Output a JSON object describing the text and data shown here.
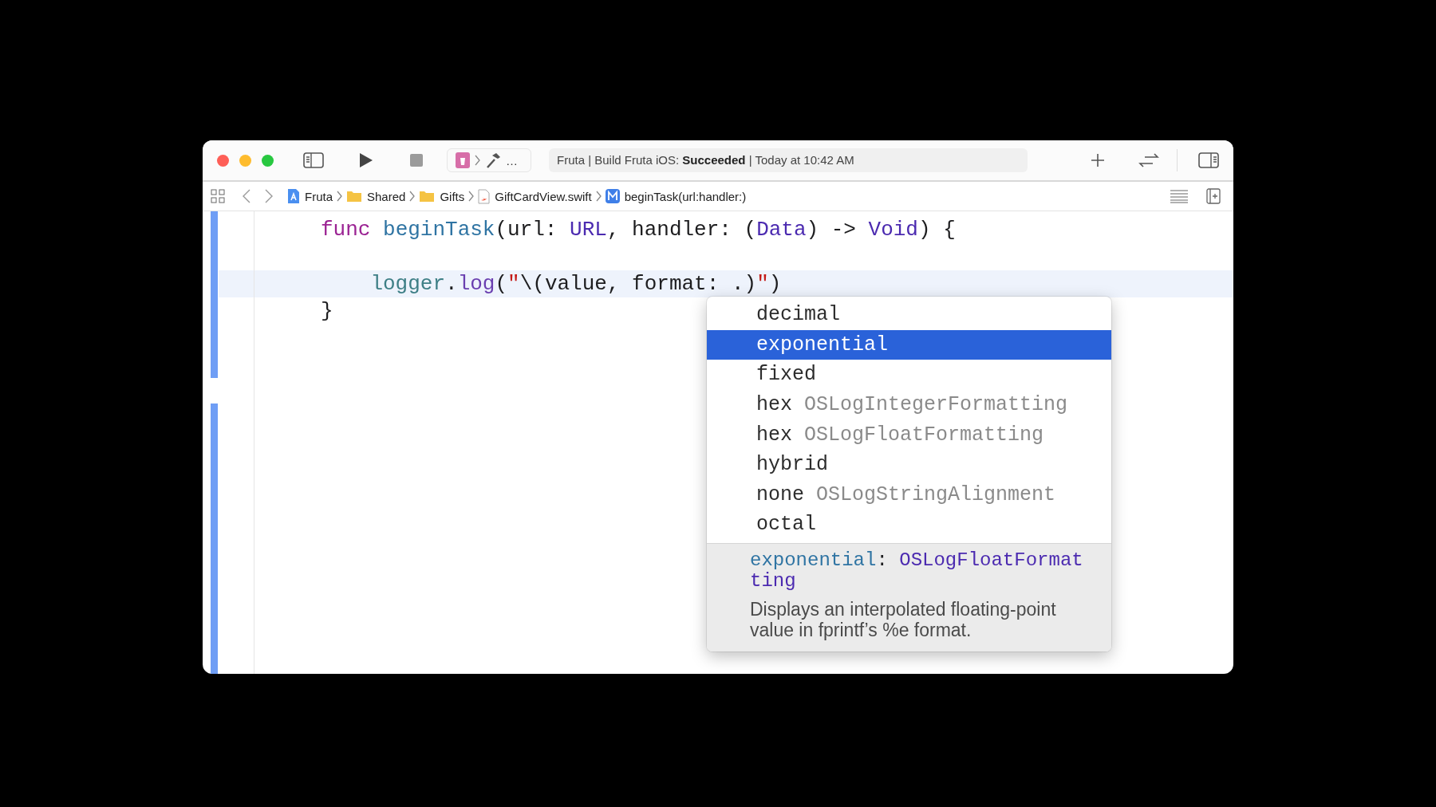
{
  "toolbar": {
    "scheme_more": "…",
    "status": "Fruta | Build Fruta iOS: **Succeeded** | Today at 10:42 AM"
  },
  "breadcrumbs": [
    {
      "label": "Fruta",
      "kind": "project"
    },
    {
      "label": "Shared",
      "kind": "folder"
    },
    {
      "label": "Gifts",
      "kind": "folder"
    },
    {
      "label": "GiftCardView.swift",
      "kind": "swift"
    },
    {
      "label": "beginTask(url:handler:)",
      "kind": "method"
    }
  ],
  "editor": {
    "lines": [
      {
        "current": false,
        "tokens": [
          {
            "text": "func",
            "kind": "keyword"
          },
          {
            "text": " beginTask",
            "kind": "declaration"
          },
          {
            "text": "(url: ",
            "kind": "plain"
          },
          {
            "text": "URL",
            "kind": "type"
          },
          {
            "text": ", handler: (",
            "kind": "plain"
          },
          {
            "text": "Data",
            "kind": "type"
          },
          {
            "text": ") -> ",
            "kind": "plain"
          },
          {
            "text": "Void",
            "kind": "type"
          },
          {
            "text": ") {",
            "kind": "plain"
          }
        ]
      },
      {
        "kind": "blank"
      },
      {
        "current": true,
        "tokens": [
          {
            "text": "    logger",
            "kind": "variable"
          },
          {
            "text": ".",
            "kind": "plain"
          },
          {
            "text": "log",
            "kind": "method"
          },
          {
            "text": "(",
            "kind": "plain"
          },
          {
            "text": "\"",
            "kind": "string"
          },
          {
            "text": "\\(value, format: .)",
            "kind": "plain"
          },
          {
            "text": "\"",
            "kind": "string"
          },
          {
            "text": ")",
            "kind": "plain"
          }
        ]
      },
      {
        "current": false,
        "tokens": [
          {
            "text": "}",
            "kind": "plain"
          }
        ]
      }
    ]
  },
  "completion": {
    "items": [
      {
        "name": "decimal",
        "selected": false
      },
      {
        "name": "exponential",
        "selected": true
      },
      {
        "name": "fixed",
        "selected": false
      },
      {
        "name": "hex",
        "type": "OSLogIntegerFormatting",
        "selected": false
      },
      {
        "name": "hex",
        "type": "OSLogFloatFormatting",
        "selected": false
      },
      {
        "name": "hybrid",
        "selected": false
      },
      {
        "name": "none",
        "type": "OSLogStringAlignment",
        "selected": false
      },
      {
        "name": "octal",
        "selected": false
      }
    ],
    "doc": {
      "signature": [
        {
          "text": "exponential",
          "kind": "declaration"
        },
        {
          "text": ": ",
          "kind": "plain"
        },
        {
          "text": "OSLogFloatFormatting",
          "kind": "type"
        }
      ],
      "description": "Displays an interpolated floating-point value in fprintf’s %e format."
    }
  }
}
